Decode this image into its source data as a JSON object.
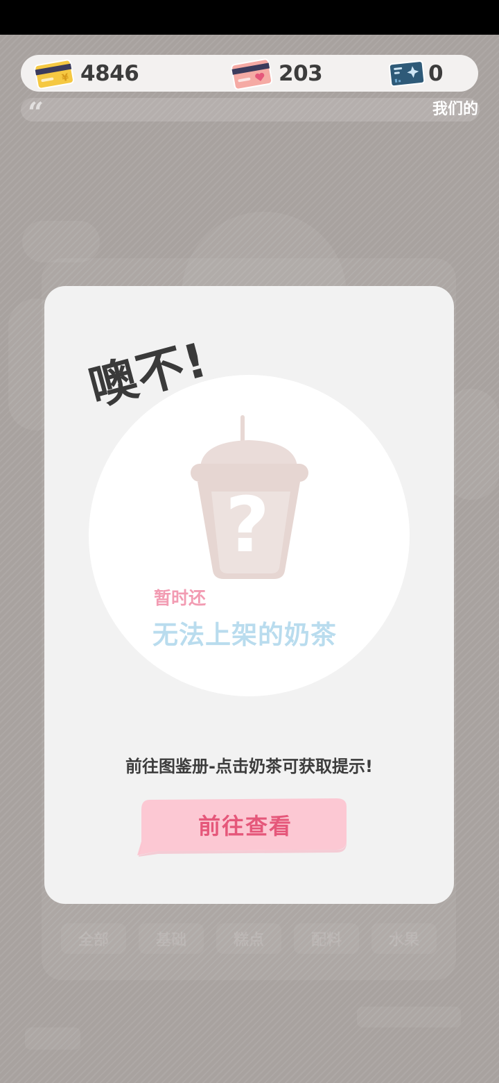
{
  "currency": {
    "gold_card": {
      "value": "4846",
      "icon": "gold-card-icon",
      "color": "#f5c842"
    },
    "heart_card": {
      "value": "203",
      "icon": "heart-card-icon",
      "color": "#f5a3a0"
    },
    "blue_card": {
      "value": "0",
      "icon": "blue-card-icon",
      "color": "#2e5a78"
    }
  },
  "notice": {
    "text": "我们的"
  },
  "modal": {
    "title": "噢不!",
    "subtitle_small": "暂时还",
    "subtitle_large": "无法上架的奶茶",
    "hint": "前往图鉴册-点击奶茶可获取提示!",
    "button_label": "前往查看",
    "mystery_icon": "question-cup-icon"
  },
  "background": {
    "tabs": [
      "全部",
      "基础",
      "糕点",
      "配料",
      "水果"
    ]
  },
  "colors": {
    "overlay": "#a8a29f",
    "modal_bg": "#f2f2f2",
    "button_bg": "#fcc8d3",
    "button_text": "#e5577a",
    "subtitle_pink": "#f29bb2",
    "subtitle_blue": "#b9dcee"
  }
}
